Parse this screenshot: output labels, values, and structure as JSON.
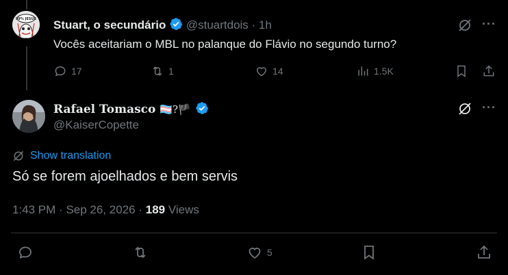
{
  "reply_tweet": {
    "display_name": "Stuart, o secundário",
    "handle": "@stuartdois",
    "time": "· 1h",
    "text": "Vocês aceitariam o MBL no palanque do Flávio no segundo turno?",
    "actions": {
      "replies": "17",
      "retweets": "1",
      "likes": "14",
      "views": "1.5K"
    },
    "avatar_text": "99% JESUS"
  },
  "main_tweet": {
    "display_name": "Rafael Tomasco",
    "name_emojis": "🏳‍⚧?🏴",
    "handle": "@KaiserCopette",
    "translation_link": "Show translation",
    "text": "Só se forem ajoelhados e bem servis",
    "time": "1:43 PM",
    "date": "Sep 26, 2026",
    "views_count": "189",
    "views_label": "Views",
    "actions": {
      "likes": "5"
    }
  },
  "colors": {
    "background": "#000000",
    "text": "#e7e9ea",
    "muted": "#71767b",
    "link": "#1d9bf0",
    "verified": "#1d9bf0"
  }
}
